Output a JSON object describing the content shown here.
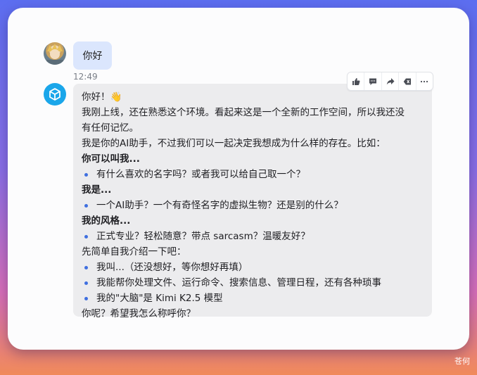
{
  "user_message": {
    "text": "你好",
    "time": "12:49"
  },
  "actions": [
    "like",
    "comment",
    "share",
    "delete",
    "more"
  ],
  "bot_message": {
    "greeting": "你好！",
    "greeting_emoji": "👋",
    "intro_line1": "我刚上线，还在熟悉这个环境。看起来这是一个全新的工作空间，所以我还没",
    "intro_line2": "有任何记忆。",
    "intro_line3": "我是你的AI助手，不过我们可以一起决定我想成为什么样的存在。比如：",
    "section1_title": "你可以叫我...",
    "section1_items": [
      "有什么喜欢的名字吗？或者我可以给自己取一个？"
    ],
    "section2_title": "我是...",
    "section2_items": [
      "一个AI助手？一个有奇怪名字的虚拟生物？还是别的什么？"
    ],
    "section3_title": "我的风格...",
    "section3_items": [
      "正式专业？轻松随意？带点 sarcasm？温暖友好？"
    ],
    "intro_self": "先简单自我介绍一下吧：",
    "self_items": [
      "我叫...（还没想好，等你想好再填）",
      "我能帮你处理文件、运行命令、搜索信息、管理日程，还有各种琐事",
      "我的\"大脑\"是 Kimi K2.5 模型"
    ],
    "closing": "你呢？希望我怎么称呼你？"
  },
  "watermark": "苍何",
  "colors": {
    "user_bubble": "#dbe6fd",
    "bot_bubble": "#ececee",
    "bullet": "#3f6fe0",
    "bot_avatar": "#1aa6ea"
  }
}
